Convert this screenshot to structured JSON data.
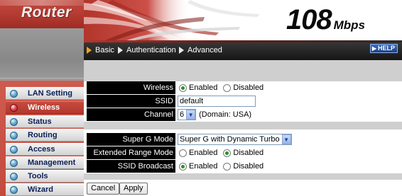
{
  "brand": "Router",
  "header": {
    "speed_number": "108",
    "speed_unit": "Mbps"
  },
  "tabs": [
    {
      "label": "Basic",
      "current": true
    },
    {
      "label": "Authentication",
      "current": false
    },
    {
      "label": "Advanced",
      "current": false
    }
  ],
  "help_label": "HELP",
  "sidebar": {
    "items": [
      {
        "label": "LAN Setting",
        "active": false
      },
      {
        "label": "Wireless",
        "active": true
      },
      {
        "label": "Status",
        "active": false
      },
      {
        "label": "Routing",
        "active": false
      },
      {
        "label": "Access",
        "active": false
      },
      {
        "label": "Management",
        "active": false
      },
      {
        "label": "Tools",
        "active": false
      },
      {
        "label": "Wizard",
        "active": false
      }
    ]
  },
  "form": {
    "wireless": {
      "label": "Wireless",
      "opt1": "Enabled",
      "opt2": "Disabled",
      "selected": "Enabled"
    },
    "ssid": {
      "label": "SSID",
      "value": "default"
    },
    "channel": {
      "label": "Channel",
      "value": "6",
      "domain": "(Domain: USA)"
    },
    "super_g": {
      "label": "Super G Mode",
      "value": "Super G with Dynamic Turbo"
    },
    "ext_range": {
      "label": "Extended Range Mode",
      "opt1": "Enabled",
      "opt2": "Disabled",
      "selected": "Disabled"
    },
    "ssid_broadcast": {
      "label": "SSID Broadcast",
      "opt1": "Enabled",
      "opt2": "Disabled",
      "selected": "Enabled"
    }
  },
  "buttons": {
    "cancel": "Cancel",
    "apply": "Apply"
  },
  "colors": {
    "accent_red": "#c34a3e",
    "label_bg": "#000000",
    "band_gray": "#cfcfcf",
    "tab_bar": "#1e1e1e"
  }
}
